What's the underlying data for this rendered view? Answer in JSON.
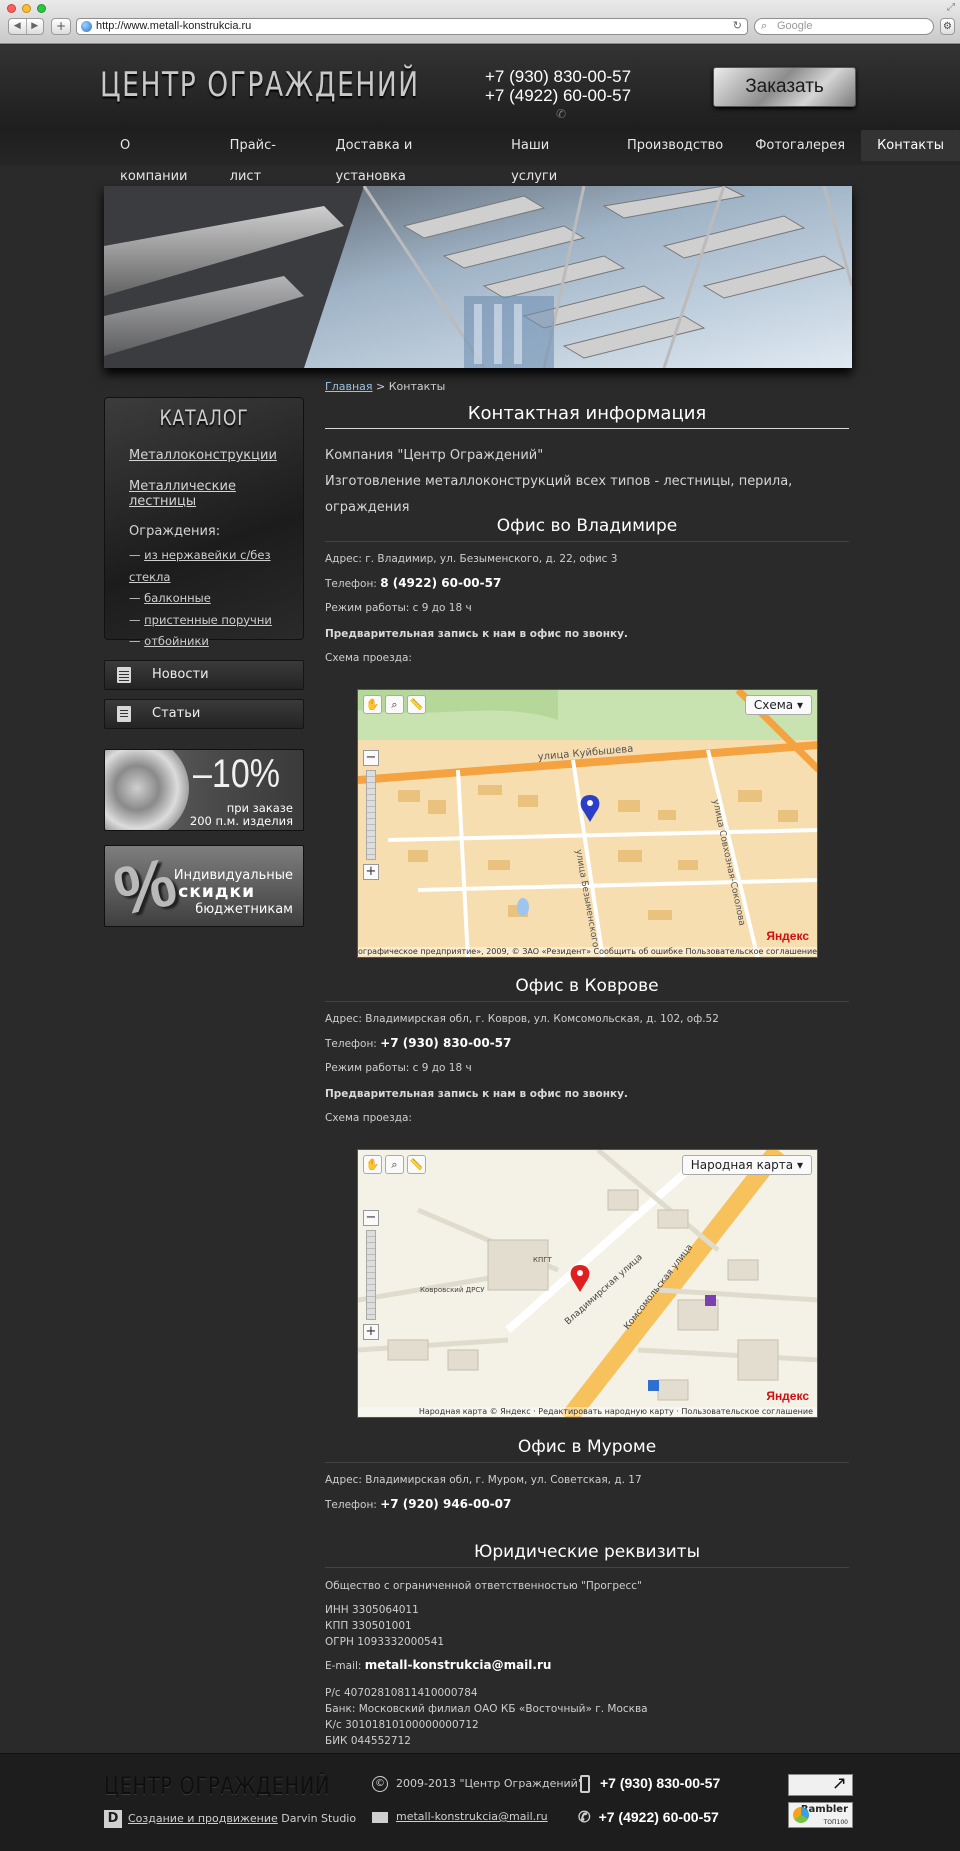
{
  "browser": {
    "url": "http://www.metall-konstrukcia.ru",
    "search_placeholder": "Google"
  },
  "header": {
    "logo": "ЦЕНТР ОГРАЖДЕНИЙ",
    "phone1": "+7 (930) 830-00-57",
    "phone2": "+7 (4922) 60-00-57",
    "order_button": "Заказать",
    "nav": [
      {
        "label": "О компании"
      },
      {
        "label": "Прайс-лист"
      },
      {
        "label": "Доставка и установка"
      },
      {
        "label": "Наши услуги"
      },
      {
        "label": "Производство"
      },
      {
        "label": "Фотогалерея"
      },
      {
        "label": "Контакты",
        "active": true
      }
    ]
  },
  "sidebar": {
    "catalog_title": "КАТАЛОГ",
    "links": [
      "Металлоконструкции",
      "Металлические лестницы"
    ],
    "fences_title": "Ограждения:",
    "fences": [
      "из нержавейки с/без стекла",
      "балконные",
      "пристенные поручни",
      "отбойники"
    ],
    "news": "Новости",
    "articles": "Статьи",
    "promo1": {
      "big": "–10%",
      "line1": "при заказе",
      "line2": "200 п.м. изделия"
    },
    "promo2": {
      "symbol": "%",
      "line1": "Индивидуальные",
      "line2": "скидки",
      "line3": "бюджетникам"
    }
  },
  "content": {
    "breadcrumb_home": "Главная",
    "breadcrumb_sep": " > ",
    "breadcrumb_current": "Контакты",
    "title": "Контактная информация",
    "company": "Компания \"Центр Ограждений\"",
    "tagline": "Изготовление металлоконструкций всех типов - лестницы, перила, ограждения",
    "office1": {
      "title": "Офис во Владимире",
      "address": "Адрес: г. Владимир, ул. Безыменского, д. 22, офис 3",
      "phone_label": "Телефон: ",
      "phone": "8 (4922) 60-00-57",
      "hours": "Режим работы: с 9 до 18 ч",
      "note": "Предварительная запись к нам в офис по звонку.",
      "scheme": "Схема проезда:",
      "map_mode": "Схема",
      "map_copyright": "ографическое предприятие», 2009, © ЗАО «Резидент»   Сообщить об ошибке   Пользовательское соглашение",
      "map_brand": "Яндекс",
      "street1": "улица Куйбышева",
      "street2": "улица Безыменского",
      "street3": "улица Совхозная-Соколова"
    },
    "office2": {
      "title": "Офис в Коврове",
      "address": "Адрес: Владимирская обл, г. Ковров, ул. Комсомольская, д. 102, оф.52",
      "phone_label": "Телефон: ",
      "phone": "+7 (930) 830-00-57",
      "hours": "Режим работы: с 9 до 18 ч",
      "note": "Предварительная запись к нам в офис по звонку.",
      "scheme": "Схема проезда:",
      "map_mode": "Народная карта",
      "map_copyright": "Народная карта © Яндекс · Редактировать народную карту · Пользовательское соглашение",
      "map_brand": "Яндекс",
      "street1": "Владимирская улица",
      "street2": "Комсомольская улица",
      "label1": "Ковровский ДРСУ",
      "label2": "КПГТ"
    },
    "office3": {
      "title": "Офис в Муроме",
      "address": "Адрес: Владимирская обл, г. Муром, ул. Советская, д. 17",
      "phone_label": "Телефон: ",
      "phone": "+7 (920) 946-00-07"
    },
    "legal": {
      "title": "Юридические реквизиты",
      "org": "Общество с ограниченной ответственностью \"Прогресс\"",
      "inn": "ИНН 3305064011",
      "kpp": "КПП 330501001",
      "ogrn": "ОГРН 1093332000541",
      "email_label": "E-mail: ",
      "email": "metall-konstrukcia@mail.ru",
      "rs": "Р/с 40702810811410000784",
      "bank": "Банк: Московский филиал ОАО КБ «Восточный» г. Москва",
      "ks": "К/с 30101810100000000712",
      "bik": "БИК 044552712"
    }
  },
  "footer": {
    "logo": "ЦЕНТР ОГРАЖДЕНИЙ",
    "dev_link": "Создание и продвижение",
    "dev_name": " Darvin Studio",
    "copyright": "2009-2013 \"Центр Ограждений\"",
    "email": "metall-konstrukcia@mail.ru",
    "phone1": "+7 (930) 830-00-57",
    "phone2": "+7 (4922) 60-00-57",
    "counter2_name": "Rambler",
    "counter2_sub": "ТОП100"
  }
}
